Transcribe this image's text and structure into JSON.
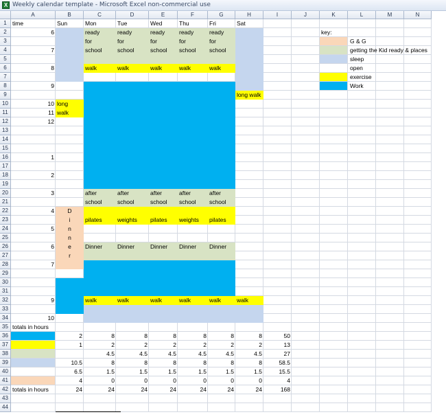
{
  "window": {
    "title": "Weekly calendar template - Microsoft Excel non-commercial use",
    "app_icon": "excel-icon",
    "app_icon_glyph": "X"
  },
  "colors": {
    "gg": "#fad7b9",
    "kid": "#d8e3c4",
    "sleep": "#c5d6ee",
    "open": "#ffffff",
    "exercise": "#ffff00",
    "work": "#00b0f0"
  },
  "grid": {
    "columns": [
      "A",
      "B",
      "C",
      "D",
      "E",
      "F",
      "G",
      "H",
      "I",
      "J",
      "K",
      "L",
      "M",
      "N"
    ],
    "row_count": 44
  },
  "calendar": {
    "header": {
      "time": "time",
      "days": [
        "Sun",
        "Mon",
        "Tue",
        "Wed",
        "Thu",
        "Fri",
        "Sat"
      ]
    },
    "hours": [
      {
        "row": 2,
        "label": "6"
      },
      {
        "row": 4,
        "label": "7"
      },
      {
        "row": 6,
        "label": "8"
      },
      {
        "row": 8,
        "label": "9"
      },
      {
        "row": 10,
        "label": "10"
      },
      {
        "row": 11,
        "label": "11"
      },
      {
        "row": 12,
        "label": "12"
      },
      {
        "row": 16,
        "label": "1"
      },
      {
        "row": 18,
        "label": "2"
      },
      {
        "row": 20,
        "label": "3"
      },
      {
        "row": 22,
        "label": "4"
      },
      {
        "row": 24,
        "label": "5"
      },
      {
        "row": 26,
        "label": "6"
      },
      {
        "row": 28,
        "label": "7"
      },
      {
        "row": 32,
        "label": "9"
      },
      {
        "row": 34,
        "label": "10"
      }
    ],
    "blocks": [
      {
        "col": "B",
        "from": 2,
        "to": 7,
        "activity": "sleep"
      },
      {
        "col": "H",
        "from": 2,
        "to": 8,
        "activity": "sleep"
      },
      {
        "col": "C",
        "from": 2,
        "to": 5,
        "activity": "kid"
      },
      {
        "col": "D",
        "from": 2,
        "to": 5,
        "activity": "kid"
      },
      {
        "col": "E",
        "from": 2,
        "to": 5,
        "activity": "kid"
      },
      {
        "col": "F",
        "from": 2,
        "to": 5,
        "activity": "kid"
      },
      {
        "col": "G",
        "from": 2,
        "to": 5,
        "activity": "kid"
      },
      {
        "col": "C",
        "from": 6,
        "to": 6,
        "activity": "exercise"
      },
      {
        "col": "D",
        "from": 6,
        "to": 6,
        "activity": "exercise"
      },
      {
        "col": "E",
        "from": 6,
        "to": 6,
        "activity": "exercise"
      },
      {
        "col": "F",
        "from": 6,
        "to": 6,
        "activity": "exercise"
      },
      {
        "col": "G",
        "from": 6,
        "to": 6,
        "activity": "exercise"
      },
      {
        "col": "C",
        "from": 8,
        "to": 19,
        "activity": "work"
      },
      {
        "col": "D",
        "from": 8,
        "to": 19,
        "activity": "work"
      },
      {
        "col": "E",
        "from": 8,
        "to": 19,
        "activity": "work"
      },
      {
        "col": "F",
        "from": 8,
        "to": 19,
        "activity": "work"
      },
      {
        "col": "G",
        "from": 8,
        "to": 19,
        "activity": "work"
      },
      {
        "col": "B",
        "from": 10,
        "to": 11,
        "activity": "exercise"
      },
      {
        "col": "H",
        "from": 9,
        "to": 9,
        "activity": "exercise"
      },
      {
        "col": "C",
        "from": 20,
        "to": 21,
        "activity": "kid"
      },
      {
        "col": "D",
        "from": 20,
        "to": 21,
        "activity": "kid"
      },
      {
        "col": "E",
        "from": 20,
        "to": 21,
        "activity": "kid"
      },
      {
        "col": "F",
        "from": 20,
        "to": 21,
        "activity": "kid"
      },
      {
        "col": "G",
        "from": 20,
        "to": 21,
        "activity": "kid"
      },
      {
        "col": "C",
        "from": 22,
        "to": 23,
        "activity": "exercise"
      },
      {
        "col": "D",
        "from": 22,
        "to": 23,
        "activity": "exercise"
      },
      {
        "col": "E",
        "from": 22,
        "to": 23,
        "activity": "exercise"
      },
      {
        "col": "F",
        "from": 22,
        "to": 23,
        "activity": "exercise"
      },
      {
        "col": "G",
        "from": 22,
        "to": 23,
        "activity": "exercise"
      },
      {
        "col": "B",
        "from": 22,
        "to": 28,
        "activity": "gg"
      },
      {
        "col": "C",
        "from": 26,
        "to": 27,
        "activity": "kid"
      },
      {
        "col": "D",
        "from": 26,
        "to": 27,
        "activity": "kid"
      },
      {
        "col": "E",
        "from": 26,
        "to": 27,
        "activity": "kid"
      },
      {
        "col": "F",
        "from": 26,
        "to": 27,
        "activity": "kid"
      },
      {
        "col": "G",
        "from": 26,
        "to": 27,
        "activity": "kid"
      },
      {
        "col": "C",
        "from": 28,
        "to": 31,
        "activity": "work"
      },
      {
        "col": "D",
        "from": 28,
        "to": 31,
        "activity": "work"
      },
      {
        "col": "E",
        "from": 28,
        "to": 31,
        "activity": "work"
      },
      {
        "col": "F",
        "from": 28,
        "to": 31,
        "activity": "work"
      },
      {
        "col": "G",
        "from": 28,
        "to": 31,
        "activity": "work"
      },
      {
        "col": "B",
        "from": 30,
        "to": 33,
        "activity": "work"
      },
      {
        "col": "C",
        "from": 32,
        "to": 32,
        "activity": "exercise"
      },
      {
        "col": "D",
        "from": 32,
        "to": 32,
        "activity": "exercise"
      },
      {
        "col": "E",
        "from": 32,
        "to": 32,
        "activity": "exercise"
      },
      {
        "col": "F",
        "from": 32,
        "to": 32,
        "activity": "exercise"
      },
      {
        "col": "G",
        "from": 32,
        "to": 32,
        "activity": "exercise"
      },
      {
        "col": "H",
        "from": 32,
        "to": 32,
        "activity": "exercise"
      },
      {
        "col": "C",
        "from": 33,
        "to": 34,
        "activity": "sleep"
      },
      {
        "col": "D",
        "from": 33,
        "to": 34,
        "activity": "sleep"
      },
      {
        "col": "E",
        "from": 33,
        "to": 34,
        "activity": "sleep"
      },
      {
        "col": "F",
        "from": 33,
        "to": 34,
        "activity": "sleep"
      },
      {
        "col": "G",
        "from": 33,
        "to": 34,
        "activity": "sleep"
      },
      {
        "col": "H",
        "from": 33,
        "to": 34,
        "activity": "sleep"
      }
    ],
    "texts": [
      {
        "col": "C",
        "row": 2,
        "text": "ready"
      },
      {
        "col": "D",
        "row": 2,
        "text": "ready"
      },
      {
        "col": "E",
        "row": 2,
        "text": "ready"
      },
      {
        "col": "F",
        "row": 2,
        "text": "ready"
      },
      {
        "col": "G",
        "row": 2,
        "text": "ready"
      },
      {
        "col": "C",
        "row": 3,
        "text": "for"
      },
      {
        "col": "D",
        "row": 3,
        "text": "for"
      },
      {
        "col": "E",
        "row": 3,
        "text": "for"
      },
      {
        "col": "F",
        "row": 3,
        "text": "for"
      },
      {
        "col": "G",
        "row": 3,
        "text": "for"
      },
      {
        "col": "C",
        "row": 4,
        "text": "school"
      },
      {
        "col": "D",
        "row": 4,
        "text": "school"
      },
      {
        "col": "E",
        "row": 4,
        "text": "school"
      },
      {
        "col": "F",
        "row": 4,
        "text": "school"
      },
      {
        "col": "G",
        "row": 4,
        "text": "school"
      },
      {
        "col": "C",
        "row": 6,
        "text": "walk"
      },
      {
        "col": "D",
        "row": 6,
        "text": "walk"
      },
      {
        "col": "E",
        "row": 6,
        "text": "walk"
      },
      {
        "col": "F",
        "row": 6,
        "text": "walk"
      },
      {
        "col": "G",
        "row": 6,
        "text": "walk"
      },
      {
        "col": "H",
        "row": 9,
        "text": "long walk"
      },
      {
        "col": "B",
        "row": 10,
        "text": "long"
      },
      {
        "col": "B",
        "row": 11,
        "text": "walk"
      },
      {
        "col": "C",
        "row": 20,
        "text": "after"
      },
      {
        "col": "D",
        "row": 20,
        "text": "after"
      },
      {
        "col": "E",
        "row": 20,
        "text": "after"
      },
      {
        "col": "F",
        "row": 20,
        "text": "after"
      },
      {
        "col": "G",
        "row": 20,
        "text": "after"
      },
      {
        "col": "C",
        "row": 21,
        "text": "school"
      },
      {
        "col": "D",
        "row": 21,
        "text": "school"
      },
      {
        "col": "E",
        "row": 21,
        "text": "school"
      },
      {
        "col": "F",
        "row": 21,
        "text": "school"
      },
      {
        "col": "G",
        "row": 21,
        "text": "school"
      },
      {
        "col": "C",
        "row": 23,
        "text": "pilates"
      },
      {
        "col": "D",
        "row": 23,
        "text": "weights"
      },
      {
        "col": "E",
        "row": 23,
        "text": "pilates"
      },
      {
        "col": "F",
        "row": 23,
        "text": "weights"
      },
      {
        "col": "G",
        "row": 23,
        "text": "pilates"
      },
      {
        "col": "B",
        "row": 22,
        "text": "D",
        "align": "center"
      },
      {
        "col": "B",
        "row": 23,
        "text": "i",
        "align": "center"
      },
      {
        "col": "B",
        "row": 24,
        "text": "n",
        "align": "center"
      },
      {
        "col": "B",
        "row": 25,
        "text": "n",
        "align": "center"
      },
      {
        "col": "B",
        "row": 26,
        "text": "e",
        "align": "center"
      },
      {
        "col": "B",
        "row": 27,
        "text": "r",
        "align": "center"
      },
      {
        "col": "C",
        "row": 26,
        "text": "Dinner"
      },
      {
        "col": "D",
        "row": 26,
        "text": "Dinner"
      },
      {
        "col": "E",
        "row": 26,
        "text": "Dinner"
      },
      {
        "col": "F",
        "row": 26,
        "text": "Dinner"
      },
      {
        "col": "G",
        "row": 26,
        "text": "Dinner"
      },
      {
        "col": "C",
        "row": 32,
        "text": "walk"
      },
      {
        "col": "D",
        "row": 32,
        "text": "walk"
      },
      {
        "col": "E",
        "row": 32,
        "text": "walk"
      },
      {
        "col": "F",
        "row": 32,
        "text": "walk"
      },
      {
        "col": "G",
        "row": 32,
        "text": "walk"
      },
      {
        "col": "H",
        "row": 32,
        "text": "walk"
      }
    ]
  },
  "legend": {
    "title": "key:",
    "items": [
      {
        "activity": "gg",
        "label": "G & G"
      },
      {
        "activity": "kid",
        "label": "getting the Kid ready & places"
      },
      {
        "activity": "sleep",
        "label": "sleep"
      },
      {
        "activity": "open",
        "label": "open"
      },
      {
        "activity": "exercise",
        "label": "exercise"
      },
      {
        "activity": "work",
        "label": "Work"
      }
    ]
  },
  "totals": {
    "header": "totals in hours",
    "rows": [
      {
        "activity": "work",
        "values": [
          "2",
          "8",
          "8",
          "8",
          "8",
          "8",
          "8",
          "50"
        ]
      },
      {
        "activity": "exercise",
        "values": [
          "1",
          "2",
          "2",
          "2",
          "2",
          "2",
          "2",
          "13"
        ]
      },
      {
        "activity": "kid",
        "values": [
          "",
          "4.5",
          "4.5",
          "4.5",
          "4.5",
          "4.5",
          "4.5",
          "27"
        ]
      },
      {
        "activity": "sleep",
        "values": [
          "10.5",
          "8",
          "8",
          "8",
          "8",
          "8",
          "8",
          "58.5"
        ]
      },
      {
        "activity": "open",
        "values": [
          "6.5",
          "1.5",
          "1.5",
          "1.5",
          "1.5",
          "1.5",
          "1.5",
          "15.5"
        ]
      },
      {
        "activity": "gg",
        "values": [
          "4",
          "0",
          "0",
          "0",
          "0",
          "0",
          "0",
          "4"
        ]
      }
    ],
    "footer_label": "totals in hours",
    "footer_values": [
      "24",
      "24",
      "24",
      "24",
      "24",
      "24",
      "24",
      "168"
    ]
  }
}
